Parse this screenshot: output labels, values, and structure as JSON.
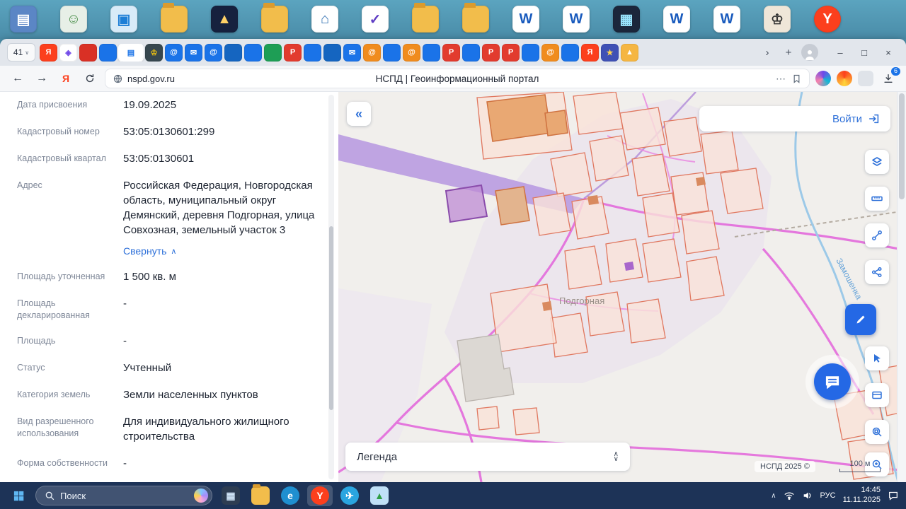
{
  "desktop": {
    "icons": [
      {
        "type": "square",
        "color": "#5b86c5",
        "fg": "#ffffff",
        "glyph": "▤"
      },
      {
        "type": "square",
        "color": "#e7efe7",
        "fg": "#4a8f4a",
        "glyph": "☺"
      },
      {
        "type": "square",
        "color": "#d8ebf8",
        "fg": "#1c7ed6",
        "glyph": "▣"
      },
      {
        "type": "folder",
        "color": "#f2bd4b",
        "fg": "#a8761f",
        "glyph": ""
      },
      {
        "type": "square",
        "color": "#16213e",
        "fg": "#ffd166",
        "glyph": "▲"
      },
      {
        "type": "folder",
        "color": "#f2bd4b",
        "fg": "#a8761f",
        "glyph": ""
      },
      {
        "type": "square",
        "color": "#ffffff",
        "fg": "#2b6cb0",
        "glyph": "⌂"
      },
      {
        "type": "square",
        "color": "#ffffff",
        "fg": "#5f3dc4",
        "glyph": "✓"
      },
      {
        "type": "folder",
        "color": "#f2bd4b",
        "fg": "#a8761f",
        "glyph": ""
      },
      {
        "type": "folder",
        "color": "#f2bd4b",
        "fg": "#a8761f",
        "glyph": ""
      },
      {
        "type": "square",
        "color": "#ffffff",
        "fg": "#185abd",
        "glyph": "W"
      },
      {
        "type": "square",
        "color": "#ffffff",
        "fg": "#185abd",
        "glyph": "W"
      },
      {
        "type": "square",
        "color": "#1b263b",
        "fg": "#9ae6ff",
        "glyph": "▦"
      },
      {
        "type": "square",
        "color": "#ffffff",
        "fg": "#185abd",
        "glyph": "W"
      },
      {
        "type": "square",
        "color": "#ffffff",
        "fg": "#185abd",
        "glyph": "W"
      },
      {
        "type": "square",
        "color": "#efe6d8",
        "fg": "#333333",
        "glyph": "♔"
      },
      {
        "type": "circle",
        "color": "#fc3f1d",
        "fg": "#ffffff",
        "glyph": "Y"
      }
    ]
  },
  "browser": {
    "tab_counter": "41",
    "tab_counter_chevron": "∨",
    "tabs": [
      {
        "bg": "#fc3f1d",
        "fg": "#ffffff",
        "glyph": "Я"
      },
      {
        "bg": "#ffffff",
        "fg": "#7048e8",
        "glyph": "◈"
      },
      {
        "bg": "#d93025",
        "fg": "#ffffff",
        "glyph": ""
      },
      {
        "bg": "#1a73e8",
        "fg": "#ffffff",
        "glyph": ""
      },
      {
        "bg": "#ffffff",
        "fg": "#1a73e8",
        "glyph": "▤",
        "active": "true"
      },
      {
        "bg": "#37474f",
        "fg": "#f1c40f",
        "glyph": "♔"
      },
      {
        "bg": "#1a73e8",
        "fg": "#ffffff",
        "glyph": "@"
      },
      {
        "bg": "#1a73e8",
        "fg": "#ffffff",
        "glyph": "✉"
      },
      {
        "bg": "#1a73e8",
        "fg": "#ffffff",
        "glyph": "@"
      },
      {
        "bg": "#1565c0",
        "fg": "#ffffff",
        "glyph": ""
      },
      {
        "bg": "#1a73e8",
        "fg": "#ffffff",
        "glyph": ""
      },
      {
        "bg": "#1e9e55",
        "fg": "#ffffff",
        "glyph": ""
      },
      {
        "bg": "#e23b2e",
        "fg": "#ffffff",
        "glyph": "P"
      },
      {
        "bg": "#1a73e8",
        "fg": "#ffffff",
        "glyph": ""
      },
      {
        "bg": "#1565c0",
        "fg": "#ffffff",
        "glyph": ""
      },
      {
        "bg": "#1a73e8",
        "fg": "#ffffff",
        "glyph": "✉"
      },
      {
        "bg": "#f08c1e",
        "fg": "#ffffff",
        "glyph": "@"
      },
      {
        "bg": "#1a73e8",
        "fg": "#ffffff",
        "glyph": ""
      },
      {
        "bg": "#f08c1e",
        "fg": "#ffffff",
        "glyph": "@"
      },
      {
        "bg": "#1a73e8",
        "fg": "#ffffff",
        "glyph": ""
      },
      {
        "bg": "#e23b2e",
        "fg": "#ffffff",
        "glyph": "P"
      },
      {
        "bg": "#1a73e8",
        "fg": "#ffffff",
        "glyph": ""
      },
      {
        "bg": "#e23b2e",
        "fg": "#ffffff",
        "glyph": "P"
      },
      {
        "bg": "#e23b2e",
        "fg": "#ffffff",
        "glyph": "P"
      },
      {
        "bg": "#1a73e8",
        "fg": "#ffffff",
        "glyph": ""
      },
      {
        "bg": "#f08c1e",
        "fg": "#ffffff",
        "glyph": "@"
      },
      {
        "bg": "#1a73e8",
        "fg": "#ffffff",
        "glyph": ""
      },
      {
        "bg": "#fc3f1d",
        "fg": "#ffffff",
        "glyph": "Я"
      },
      {
        "bg": "#3f51b5",
        "fg": "#ffd54f",
        "glyph": "★"
      },
      {
        "bg": "#f5b642",
        "fg": "#ffffff",
        "glyph": "▲"
      }
    ],
    "overflow": "›",
    "new_tab": "+",
    "window_controls": {
      "minimize": "–",
      "maximize": "□",
      "close": "×"
    },
    "nav": {
      "back": "←",
      "forward": "→",
      "services": "Я"
    },
    "address": {
      "url": "nspd.gov.ru",
      "title": "НСПД | Геоинформационный портал",
      "more": "⋯",
      "download_badge": "6"
    }
  },
  "panel": {
    "fields_top": [
      {
        "label": "Дата присвоения",
        "value": "19.09.2025"
      },
      {
        "label": "Кадастровый номер",
        "value": "53:05:0130601:299"
      },
      {
        "label": "Кадастровый квартал",
        "value": "53:05:0130601"
      },
      {
        "label": "Адрес",
        "value": "Российская Федерация, Новгородская область, муниципальный округ Демянский, деревня Подгорная, улица Совхозная, земельный участок 3"
      }
    ],
    "collapse": {
      "label": "Свернуть",
      "chevron": "∧"
    },
    "fields_bottom": [
      {
        "label": "Площадь уточненная",
        "value": "1 500 кв. м"
      },
      {
        "label": "Площадь декларированная",
        "value": "-"
      },
      {
        "label": "Площадь",
        "value": "-"
      },
      {
        "label": "Статус",
        "value": "Учтенный"
      },
      {
        "label": "Категория земель",
        "value": "Земли населенных пунктов"
      },
      {
        "label": "Вид разрешенного использования",
        "value": "Для индивидуального жилищного строительства"
      },
      {
        "label": "Форма собственности",
        "value": "-"
      }
    ]
  },
  "map": {
    "collapse_glyph": "«",
    "login": "Войти",
    "legend": {
      "label": "Легенда",
      "up": "∧",
      "down": "∨"
    },
    "attribution": "НСПД 2025 ©",
    "scale": "100 м",
    "labels": {
      "place": "Подгорная",
      "river": "Замошенка"
    }
  },
  "taskbar": {
    "search": "Поиск",
    "apps": [
      {
        "type": "square",
        "color": "#2e3d52",
        "fg": "#cfe3f5",
        "glyph": "▦"
      },
      {
        "type": "folder",
        "color": "#f2bd4b",
        "fg": "#a8761f",
        "glyph": ""
      },
      {
        "type": "circle",
        "color": "#1f8fd0",
        "fg": "#ffffff",
        "glyph": "e"
      },
      {
        "type": "circle",
        "color": "#fc3f1d",
        "fg": "#ffffff",
        "glyph": "Y",
        "active": "true"
      },
      {
        "type": "circle",
        "color": "#2aa5e0",
        "fg": "#ffffff",
        "glyph": "✈"
      },
      {
        "type": "square",
        "color": "#bfe0f7",
        "fg": "#2f9e44",
        "glyph": "▲"
      }
    ],
    "tray": {
      "chevron": "∧",
      "lang": "РУС",
      "time": "14:45",
      "date": "11.11.2025"
    }
  }
}
